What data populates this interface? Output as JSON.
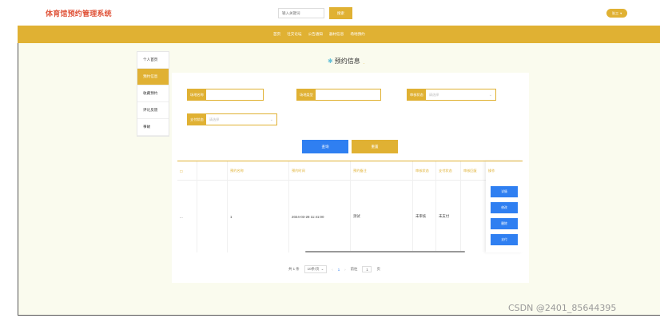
{
  "header": {
    "brand_title": "体育馆预约管理系统",
    "search_placeholder": "输入关键词",
    "search_button": "搜索",
    "user_label": "张三",
    "user_chevron": "chevron-down-icon"
  },
  "nav": {
    "items": [
      "首页",
      "社交论坛",
      "公告通知",
      "器材信息",
      "场地预约"
    ]
  },
  "sidebar": {
    "items": [
      {
        "label": "个人首页",
        "active": false
      },
      {
        "label": "预约信息",
        "active": true
      },
      {
        "label": "收藏预约",
        "active": false
      },
      {
        "label": "评论反馈",
        "active": false
      },
      {
        "label": "事故",
        "active": false
      }
    ]
  },
  "page": {
    "heading": "预约信息",
    "heading_dot": ".",
    "star_icon": "✱"
  },
  "filters": {
    "venue_name_label": "场地名称",
    "venue_type_label": "场地类型",
    "review_status_label": "审核状态",
    "review_status_placeholder": "请选择",
    "pay_status_label": "支付状态",
    "pay_status_placeholder": "请选择"
  },
  "actions": {
    "query": "查询",
    "reset": "重置"
  },
  "table": {
    "headers": [
      "预约名称",
      "预约时间",
      "预约备注",
      "审核状态",
      "支付状态",
      "审核回复",
      "操作"
    ],
    "row": {
      "index": "...",
      "name": "1",
      "time": "2024-03-28 11:41:00",
      "remark": "测试",
      "review_status": "未审核",
      "pay_status": "未支付",
      "reply": ""
    },
    "row_buttons": [
      "详情",
      "修改",
      "删除",
      "支付"
    ]
  },
  "pagination": {
    "total": "共 1 条",
    "page_size": "10条/页",
    "current_page": "1",
    "goto_label": "前往",
    "goto_value": "1",
    "goto_suffix": "页"
  },
  "watermark": "CSDN @2401_85644395",
  "colors": {
    "accent": "#e0b133",
    "brand_red": "#e0543a",
    "primary_blue": "#2f7ff1",
    "background": "#fafbee"
  }
}
